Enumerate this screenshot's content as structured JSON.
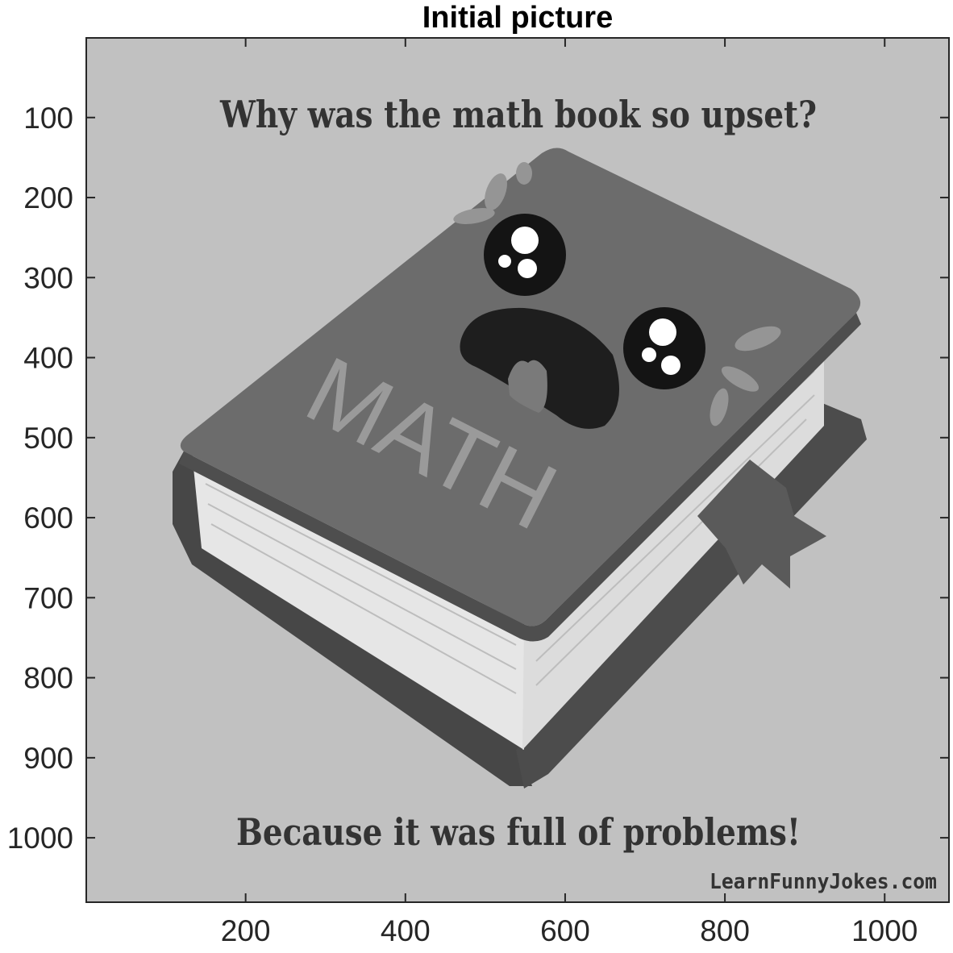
{
  "figure": {
    "title": "Initial picture",
    "x_ticks": [
      "200",
      "400",
      "600",
      "800",
      "1000"
    ],
    "y_ticks": [
      "100",
      "200",
      "300",
      "400",
      "500",
      "600",
      "700",
      "800",
      "900",
      "1000"
    ]
  },
  "image": {
    "top_text": "Why was the math book so upset?",
    "book_label": "MATH",
    "bottom_text": "Because it was full of problems!",
    "watermark": "LearnFunnyJokes.com"
  },
  "colors": {
    "background": "#c1c1c1",
    "cover": "#6e6e6e",
    "cover_edge": "#4a4a4a",
    "pages": "#e8e8e8",
    "text": "#333333"
  }
}
